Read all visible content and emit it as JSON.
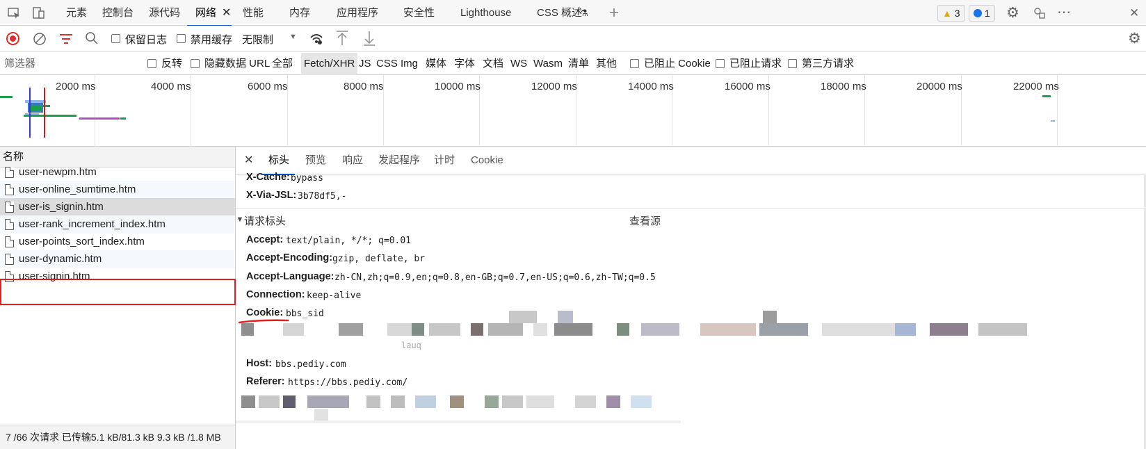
{
  "tabbar": {
    "tabs": [
      "元素",
      "控制台",
      "源代码",
      "网络",
      "性能",
      "内存",
      "应用程序",
      "安全性",
      "Lighthouse",
      "CSS 概述"
    ],
    "warnings_count": "3",
    "messages_count": "1"
  },
  "toolbar": {
    "preserve_log": "保留日志",
    "disable_cache": "禁用缓存",
    "throttling": "无限制"
  },
  "filterbar": {
    "placeholder": "筛选器",
    "invert": "反转",
    "hide_data_urls": "隐藏数据 URL",
    "types": [
      "全部",
      "Fetch/XHR",
      "JS",
      "CSS",
      "Img",
      "媒体",
      "字体",
      "文档",
      "WS",
      "Wasm",
      "清单",
      "其他"
    ],
    "blocked_cookies": "已阻止 Cookie",
    "blocked_requests": "已阻止请求",
    "third_party": "第三方请求"
  },
  "overview": {
    "ticks": [
      "2000 ms",
      "4000 ms",
      "6000 ms",
      "8000 ms",
      "10000 ms",
      "12000 ms",
      "14000 ms",
      "16000 ms",
      "18000 ms",
      "20000 ms",
      "22000 ms"
    ]
  },
  "requests": {
    "header": "名称",
    "items": [
      "user-newpm.htm",
      "user-online_sumtime.htm",
      "user-is_signin.htm",
      "user-rank_increment_index.htm",
      "user-points_sort_index.htm",
      "user-dynamic.htm",
      "user-signin.htm"
    ],
    "status": "7 /66 次请求   已传输5.1 kB/81.3 kB   9.3 kB /1.8 MB"
  },
  "details": {
    "tabs": [
      "标头",
      "预览",
      "响应",
      "发起程序",
      "计时",
      "Cookie"
    ],
    "response_headers": [
      {
        "key": "X-Cache:",
        "value": "bypass"
      },
      {
        "key": "X-Via-JSL:",
        "value": "3b78df5,-"
      }
    ],
    "request_section": "请求标头",
    "view_source": "查看源",
    "request_headers": [
      {
        "key": "Accept:",
        "value": "text/plain, */*; q=0.01"
      },
      {
        "key": "Accept-Encoding:",
        "value": "gzip, deflate, br"
      },
      {
        "key": "Accept-Language:",
        "value": "zh-CN,zh;q=0.9,en;q=0.8,en-GB;q=0.7,en-US;q=0.6,zh-TW;q=0.5"
      },
      {
        "key": "Connection:",
        "value": "keep-alive"
      },
      {
        "key": "Cookie:",
        "value": "bbs_sid"
      },
      {
        "key": "Host:",
        "value": "bbs.pediy.com"
      },
      {
        "key": "Referer:",
        "value": "https://bbs.pediy.com/"
      }
    ]
  },
  "colors": {
    "accent": "#0a5cc8",
    "highlight_red": "#e02020",
    "record_red": "#d9302e"
  }
}
